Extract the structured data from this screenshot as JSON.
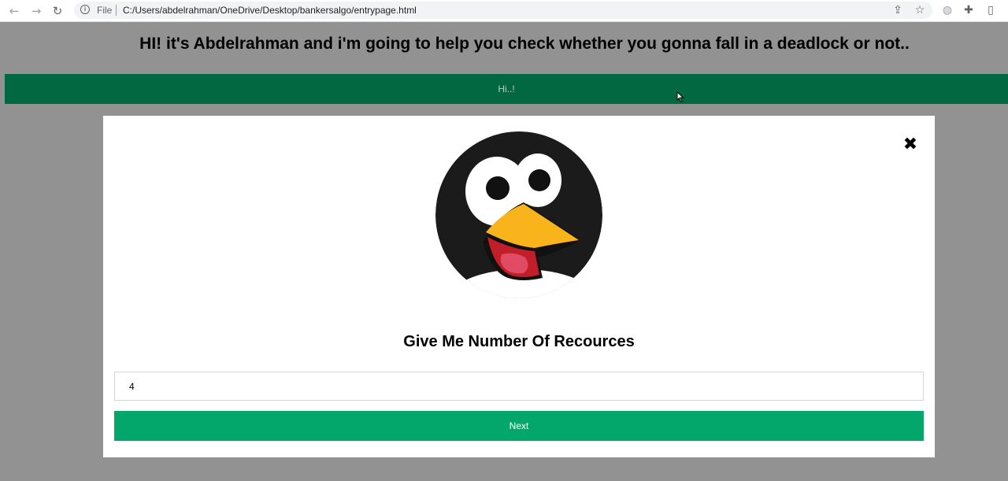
{
  "browser": {
    "scheme_label": "File",
    "url": "C:/Users/abdelrahman/OneDrive/Desktop/bankersalgo/entrypage.html",
    "icons": [
      "back-arrow-icon",
      "forward-arrow-icon",
      "reload-icon",
      "info-icon",
      "share-icon",
      "star-icon",
      "globe-icon",
      "puzzle-icon",
      "side-panel-icon"
    ]
  },
  "page": {
    "heading": "HI! it's Abdelrahman and i'm going to help you check whether you gonna fall in a deadlock or not..",
    "banner_text": "Hi..!"
  },
  "modal": {
    "title": "Give Me Number Of Recources",
    "input_value": "4",
    "next_label": "Next",
    "close_glyph": "✖"
  },
  "colors": {
    "overlay": "#929292",
    "banner": "#016842",
    "button": "#04a76b"
  }
}
